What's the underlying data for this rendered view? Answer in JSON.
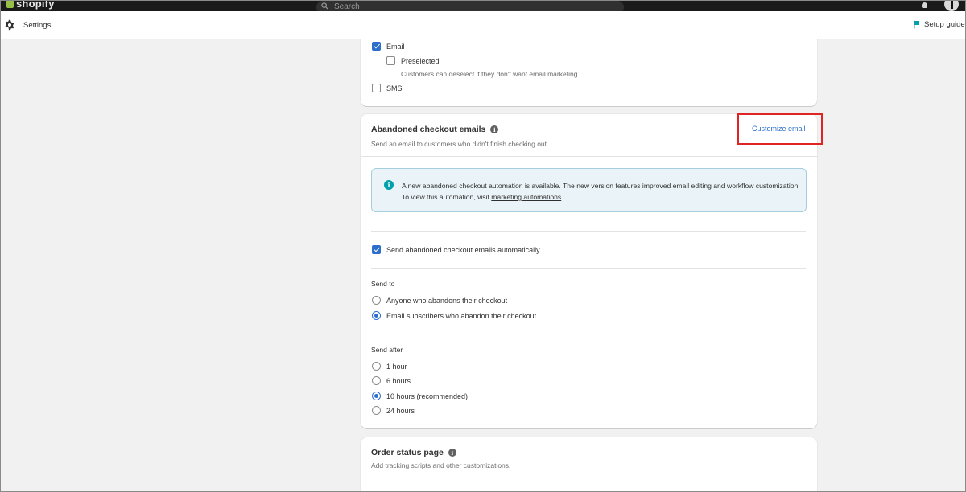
{
  "topbar": {
    "logo_text": "shopify",
    "search_placeholder": "Search"
  },
  "settings_bar": {
    "title": "Settings",
    "setup_guide": "Setup guide"
  },
  "marketing_section": {
    "email_label": "Email",
    "email_checked": true,
    "preselected_label": "Preselected",
    "preselected_checked": false,
    "preselected_hint": "Customers can deselect if they don't want email marketing.",
    "sms_label": "SMS",
    "sms_checked": false
  },
  "abandoned_checkout": {
    "title": "Abandoned checkout emails",
    "customize_link": "Customize email",
    "subtitle": "Send an email to customers who didn't finish checking out.",
    "banner": {
      "text_before_link": "A new abandoned checkout automation is available. The new version features improved email editing and workflow customization. To view this automation, visit ",
      "link_text": "marketing automations",
      "text_after_link": "."
    },
    "auto_send_label": "Send abandoned checkout emails automatically",
    "auto_send_checked": true,
    "send_to": {
      "label": "Send to",
      "options": [
        {
          "label": "Anyone who abandons their checkout",
          "selected": false
        },
        {
          "label": "Email subscribers who abandon their checkout",
          "selected": true
        }
      ]
    },
    "send_after": {
      "label": "Send after",
      "options": [
        {
          "label": "1 hour",
          "selected": false
        },
        {
          "label": "6 hours",
          "selected": false
        },
        {
          "label": "10 hours (recommended)",
          "selected": true
        },
        {
          "label": "24 hours",
          "selected": false
        }
      ]
    }
  },
  "order_status": {
    "title": "Order status page",
    "subtitle": "Add tracking scripts and other customizations."
  },
  "colors": {
    "accent": "#2c6ecb",
    "highlight_box": "#e02424",
    "banner_bg": "#eaf4f8",
    "banner_icon": "#00a0ac"
  }
}
